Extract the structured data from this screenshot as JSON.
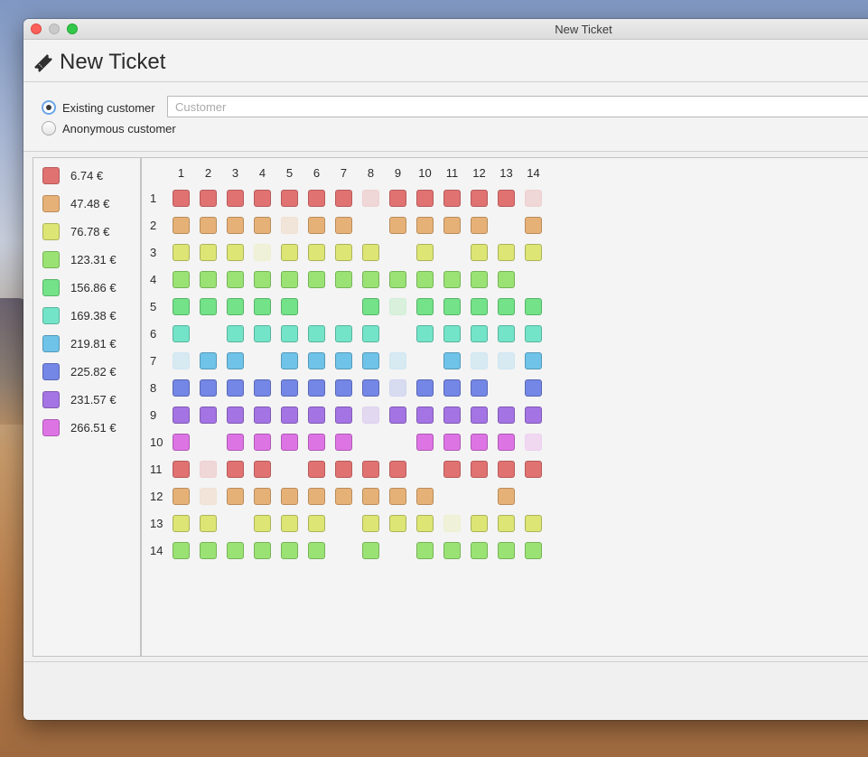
{
  "window": {
    "title": "New Ticket"
  },
  "header": {
    "title": "New Ticket",
    "icon": "ticket-icon"
  },
  "customer": {
    "existing_label": "Existing customer",
    "anonymous_label": "Anonymous customer",
    "selected": "existing",
    "input_placeholder": "Customer",
    "input_value": ""
  },
  "categories": [
    {
      "price": "6.74 €",
      "color": "#e07272",
      "border": "#b85a5a"
    },
    {
      "price": "47.48 €",
      "color": "#e6b177",
      "border": "#b98c5b"
    },
    {
      "price": "76.78 €",
      "color": "#dde574",
      "border": "#abb35a"
    },
    {
      "price": "123.31 €",
      "color": "#9be274",
      "border": "#75b457"
    },
    {
      "price": "156.86 €",
      "color": "#74e288",
      "border": "#56b468"
    },
    {
      "price": "169.38 €",
      "color": "#74e4c8",
      "border": "#56b49c"
    },
    {
      "price": "219.81 €",
      "color": "#6fc3e8",
      "border": "#5499b8"
    },
    {
      "price": "225.82 €",
      "color": "#7487e6",
      "border": "#5867b5"
    },
    {
      "price": "231.57 €",
      "color": "#a474e4",
      "border": "#805ab3"
    },
    {
      "price": "266.51 €",
      "color": "#dd74e4",
      "border": "#ad59b3"
    }
  ],
  "columns": [
    "1",
    "2",
    "3",
    "4",
    "5",
    "6",
    "7",
    "8",
    "9",
    "10",
    "11",
    "12",
    "13",
    "14"
  ],
  "rows": [
    {
      "label": "1",
      "category": 0,
      "seats": "AAAAAAAUAAAAAU"
    },
    {
      "label": "2",
      "category": 1,
      "seats": "AAAAUAA.AAAA.A"
    },
    {
      "label": "3",
      "category": 2,
      "seats": "AAAUAAAA.A.AAA"
    },
    {
      "label": "4",
      "category": 3,
      "seats": "AAAAAAAAAAAAA."
    },
    {
      "label": "5",
      "category": 4,
      "seats": "AAAAA..AUAAAAA"
    },
    {
      "label": "6",
      "category": 5,
      "seats": "A.AAAAAA.AAAAA"
    },
    {
      "label": "7",
      "category": 6,
      "seats": "UAA.AAAAU.AUUA"
    },
    {
      "label": "8",
      "category": 7,
      "seats": "AAAAAAAAUAAA.A"
    },
    {
      "label": "9",
      "category": 8,
      "seats": "AAAAAAAUAAAAAA"
    },
    {
      "label": "10",
      "category": 9,
      "seats": "A.AAAAA..AAAAU"
    },
    {
      "label": "11",
      "category": 0,
      "seats": "AUAA.AAAA.AAAA"
    },
    {
      "label": "12",
      "category": 1,
      "seats": "AUAAAAAAAA..A."
    },
    {
      "label": "13",
      "category": 2,
      "seats": "AA.AAA.AAAUAAA"
    },
    {
      "label": "14",
      "category": 3,
      "seats": "AAAAAA.A.AAAAA"
    }
  ]
}
